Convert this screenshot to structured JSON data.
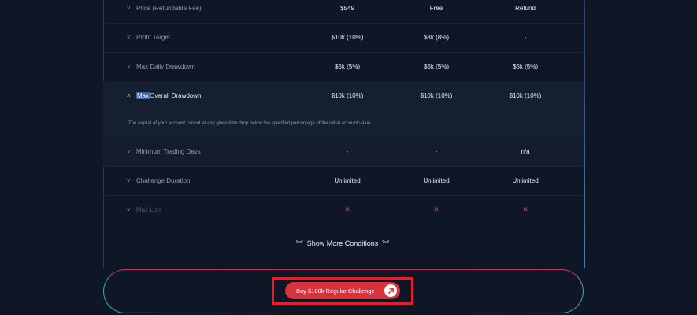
{
  "table": {
    "rows": [
      {
        "label": "Price (Refundable Fee)",
        "chevron": "˅",
        "v1": "$549",
        "v2": "Free",
        "v3": "Refund"
      },
      {
        "label": "Profit Target",
        "chevron": "˅",
        "v1": "$10k (10%)",
        "v2": "$8k (8%)",
        "v3": "-"
      },
      {
        "label": "Max Daily Drawdown",
        "chevron": "˅",
        "v1": "$5k (5%)",
        "v2": "$5k (5%)",
        "v3": "$5k (5%)"
      },
      {
        "label_highlight": "Max",
        "label_rest": " Overall Drawdown",
        "chevron": "˄",
        "v1": "$10k (10%)",
        "v2": "$10k (10%)",
        "v3": "$10k (10%)"
      },
      {
        "label": "Minimum Trading Days",
        "chevron": "˅",
        "v1": "-",
        "v2": "-",
        "v3": "n/a"
      },
      {
        "label": "Challenge Duration",
        "chevron": "˅",
        "v1": "Unlimited",
        "v2": "Unlimited",
        "v3": "Unlimited"
      },
      {
        "label": "Max Lots",
        "chevron": "˅",
        "v1": "✕",
        "v2": "✕",
        "v3": "✕"
      }
    ],
    "description": "The capital of your account cannot at any given time drop below the specified percentage of the initial account value."
  },
  "show_more": {
    "label": "Show More Conditions",
    "icon": "double-chevron-down-icon",
    "glyph": "︾"
  },
  "buy_button": {
    "label": "Buy $100k Regular Challenge",
    "icon": "arrow-up-right-icon",
    "glyph": "↗"
  },
  "colors": {
    "accent": "#d8333d",
    "background": "#0f1726",
    "highlight_box": "#e0202a"
  }
}
